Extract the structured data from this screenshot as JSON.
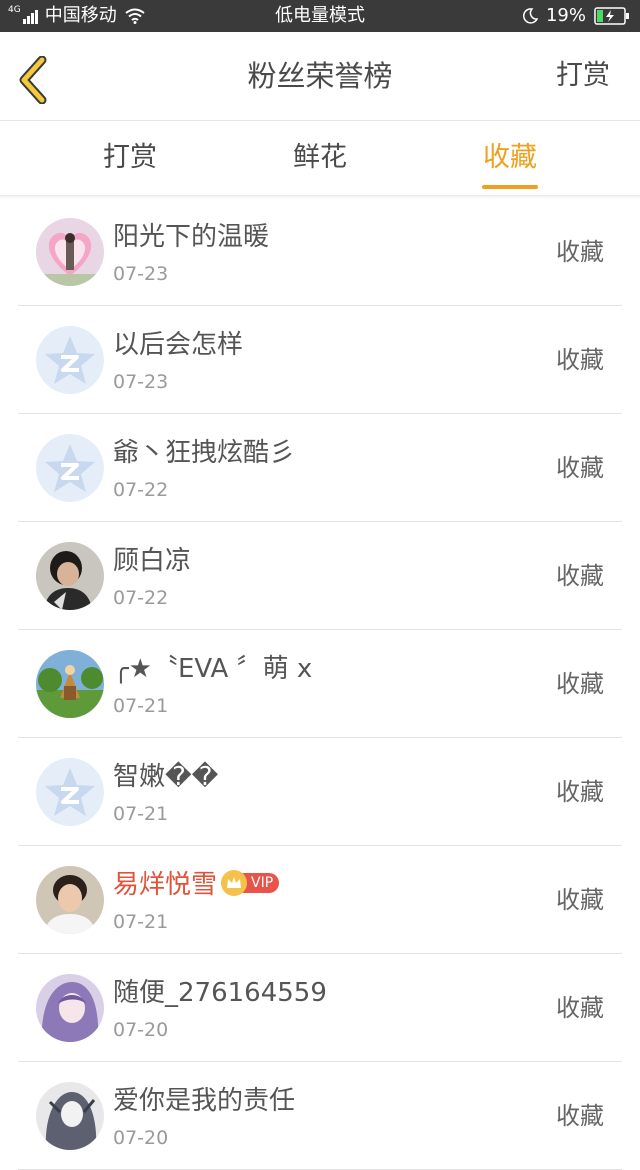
{
  "status_bar": {
    "network": "4G",
    "carrier": "中国移动",
    "mode": "低电量模式",
    "battery": "19%"
  },
  "header": {
    "title": "粉丝荣誉榜",
    "action": "打赏"
  },
  "tabs": [
    {
      "label": "打赏",
      "active": false
    },
    {
      "label": "鲜花",
      "active": false
    },
    {
      "label": "收藏",
      "active": true
    }
  ],
  "colors": {
    "accent": "#f0a020",
    "vip_name": "#e0533a"
  },
  "list": [
    {
      "name": "阳光下的温暖",
      "date": "07-23",
      "action": "收藏",
      "avatar": "photo-heart",
      "vip": false
    },
    {
      "name": "以后会怎样",
      "date": "07-23",
      "action": "收藏",
      "avatar": "default-star",
      "vip": false
    },
    {
      "name": "爺丶狂拽炫酷彡",
      "date": "07-22",
      "action": "收藏",
      "avatar": "default-star",
      "vip": false
    },
    {
      "name": "顾白凉",
      "date": "07-22",
      "action": "收藏",
      "avatar": "photo-boy",
      "vip": false
    },
    {
      "name": "╭★〝EVA 〞萌 x",
      "date": "07-21",
      "action": "收藏",
      "avatar": "photo-game",
      "vip": false
    },
    {
      "name": "智嫩��",
      "date": "07-21",
      "action": "收藏",
      "avatar": "default-star",
      "vip": false
    },
    {
      "name": "易烊悦雪",
      "date": "07-21",
      "action": "收藏",
      "avatar": "photo-man",
      "vip": true,
      "vip_label": "VIP"
    },
    {
      "name": "随便_276164559",
      "date": "07-20",
      "action": "收藏",
      "avatar": "photo-anime",
      "vip": false
    },
    {
      "name": "爱你是我的责任",
      "date": "07-20",
      "action": "收藏",
      "avatar": "photo-sketch",
      "vip": false
    }
  ]
}
